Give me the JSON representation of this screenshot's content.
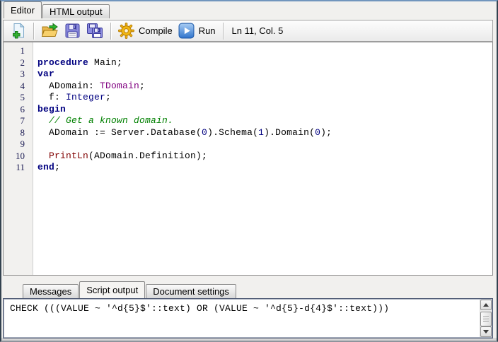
{
  "top_tabs": [
    {
      "label": "Editor",
      "active": true
    },
    {
      "label": "HTML output",
      "active": false
    }
  ],
  "toolbar": {
    "icons": {
      "new_document": "new-document-icon",
      "open": "open-folder-icon",
      "save": "save-icon",
      "save_as": "save-copy-icon",
      "compile": "compile-gear-icon",
      "run": "run-play-icon"
    },
    "compile_label": "Compile",
    "run_label": "Run",
    "caret_status": "Ln 11, Col. 5"
  },
  "editor": {
    "lines": [
      {
        "num": "1",
        "segments": []
      },
      {
        "num": "2",
        "segments": [
          {
            "text": "procedure",
            "style": "keyword"
          },
          {
            "text": " Main;",
            "style": "plain"
          }
        ]
      },
      {
        "num": "3",
        "segments": [
          {
            "text": "var",
            "style": "keyword"
          }
        ]
      },
      {
        "num": "4",
        "segments": [
          {
            "text": "  ADomain: ",
            "style": "plain"
          },
          {
            "text": "TDomain",
            "style": "type"
          },
          {
            "text": ";",
            "style": "plain"
          }
        ]
      },
      {
        "num": "5",
        "segments": [
          {
            "text": "  f: ",
            "style": "plain"
          },
          {
            "text": "Integer",
            "style": "stdtype"
          },
          {
            "text": ";",
            "style": "plain"
          }
        ]
      },
      {
        "num": "6",
        "segments": [
          {
            "text": "begin",
            "style": "keyword"
          }
        ]
      },
      {
        "num": "7",
        "segments": [
          {
            "text": "  ",
            "style": "plain"
          },
          {
            "text": "// Get a known domain.",
            "style": "comment"
          }
        ]
      },
      {
        "num": "8",
        "segments": [
          {
            "text": "  ADomain := Server.Database(",
            "style": "plain"
          },
          {
            "text": "0",
            "style": "number"
          },
          {
            "text": ").Schema(",
            "style": "plain"
          },
          {
            "text": "1",
            "style": "number"
          },
          {
            "text": ").Domain(",
            "style": "plain"
          },
          {
            "text": "0",
            "style": "number"
          },
          {
            "text": ");",
            "style": "plain"
          }
        ]
      },
      {
        "num": "9",
        "segments": []
      },
      {
        "num": "10",
        "segments": [
          {
            "text": "  ",
            "style": "plain"
          },
          {
            "text": "PrintLn",
            "style": "function"
          },
          {
            "text": "(ADomain.Definition);",
            "style": "plain"
          }
        ]
      },
      {
        "num": "11",
        "segments": [
          {
            "text": "end",
            "style": "keyword"
          },
          {
            "text": ";",
            "style": "plain"
          }
        ]
      }
    ]
  },
  "bottom_tabs": [
    {
      "label": "Messages",
      "active": false
    },
    {
      "label": "Script output",
      "active": true
    },
    {
      "label": "Document settings",
      "active": false
    }
  ],
  "output": {
    "text": "CHECK (((VALUE ~ '^d{5}$'::text) OR (VALUE ~ '^d{5}-d{4}$'::text)))"
  },
  "colors": {
    "keyword": "#000080",
    "type": "#800080",
    "stdtype": "#000080",
    "number": "#000080",
    "comment": "#008000",
    "function": "#800000"
  }
}
